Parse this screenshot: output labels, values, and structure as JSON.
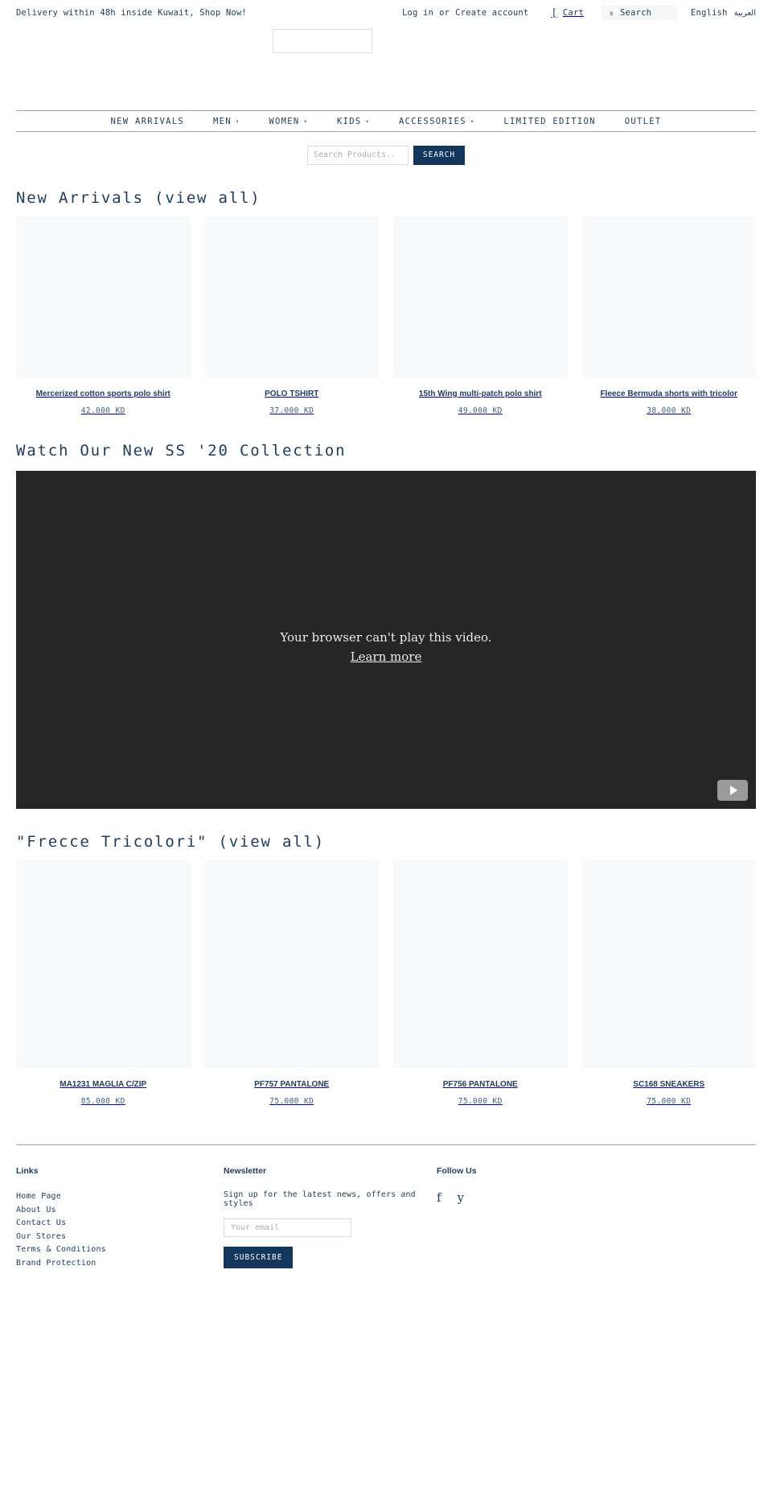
{
  "colors": {
    "brand_navy": "#12365c",
    "text_navy": "#1c3c5e",
    "button_navy": "#12365c",
    "card_placeholder": "#f8f9fb",
    "video_bg": "#262626",
    "rule": "#9aa3ab"
  },
  "topbar": {
    "announcement": "Delivery within 48h inside Kuwait, Shop Now!",
    "login_label": "Log in",
    "or_label": "or",
    "create_account_label": "Create account",
    "cart_icon": "cart-icon",
    "cart_label": "Cart",
    "search_icon": "search-icon",
    "search_label": "Search",
    "lang_english": "English",
    "lang_arabic": "العربية"
  },
  "nav": {
    "items": [
      {
        "label": "NEW ARRIVALS",
        "has_submenu": false,
        "caret": ""
      },
      {
        "label": "MEN",
        "has_submenu": true,
        "caret": "▾"
      },
      {
        "label": "WOMEN",
        "has_submenu": true,
        "caret": "▾"
      },
      {
        "label": "KIDS",
        "has_submenu": true,
        "caret": "▾"
      },
      {
        "label": "ACCESSORIES",
        "has_submenu": true,
        "caret": "▾"
      },
      {
        "label": "LIMITED EDITION",
        "has_submenu": false,
        "caret": ""
      },
      {
        "label": "OUTLET",
        "has_submenu": false,
        "caret": ""
      }
    ]
  },
  "product_search": {
    "placeholder": "Search Products..",
    "value": "",
    "button_label": "SEARCH"
  },
  "sections": {
    "new_arrivals": {
      "heading": "New Arrivals (view all)",
      "products": [
        {
          "title": "Mercerized cotton sports polo shirt",
          "price": "42.000 KD"
        },
        {
          "title": "POLO TSHIRT",
          "price": "37.000 KD"
        },
        {
          "title": "15th Wing multi-patch polo shirt",
          "price": "49.000 KD"
        },
        {
          "title": "Fleece Bermuda shorts with tricolor",
          "price": "38.000 KD"
        }
      ]
    },
    "video": {
      "heading": "Watch Our New SS '20 Collection",
      "error_message": "Your browser can't play this video.",
      "learn_more_label": "Learn more",
      "play_icon": "youtube-play-icon"
    },
    "frecce": {
      "heading": "\"Frecce Tricolori\" (view all)",
      "products": [
        {
          "title": "MA1231 MAGLIA C/ZIP",
          "price": "85.000 KD"
        },
        {
          "title": "PF757 PANTALONE",
          "price": "75.000 KD"
        },
        {
          "title": "PF756 PANTALONE",
          "price": "75.000 KD"
        },
        {
          "title": "SC168 SNEAKERS",
          "price": "75.000 KD"
        }
      ]
    }
  },
  "footer": {
    "links": {
      "heading": "Links",
      "items": [
        "Home Page",
        "About Us",
        "Contact Us",
        "Our Stores",
        "Terms & Conditions",
        "Brand Protection"
      ]
    },
    "newsletter": {
      "heading": "Newsletter",
      "description": "Sign up for the latest news, offers and styles",
      "email_placeholder": "Your email",
      "email_value": "",
      "subscribe_label": "SUBSCRIBE"
    },
    "follow": {
      "heading": "Follow Us",
      "socials": [
        {
          "icon": "facebook-icon",
          "glyph": "f"
        },
        {
          "icon": "twitter-icon",
          "glyph": "y"
        }
      ]
    }
  }
}
